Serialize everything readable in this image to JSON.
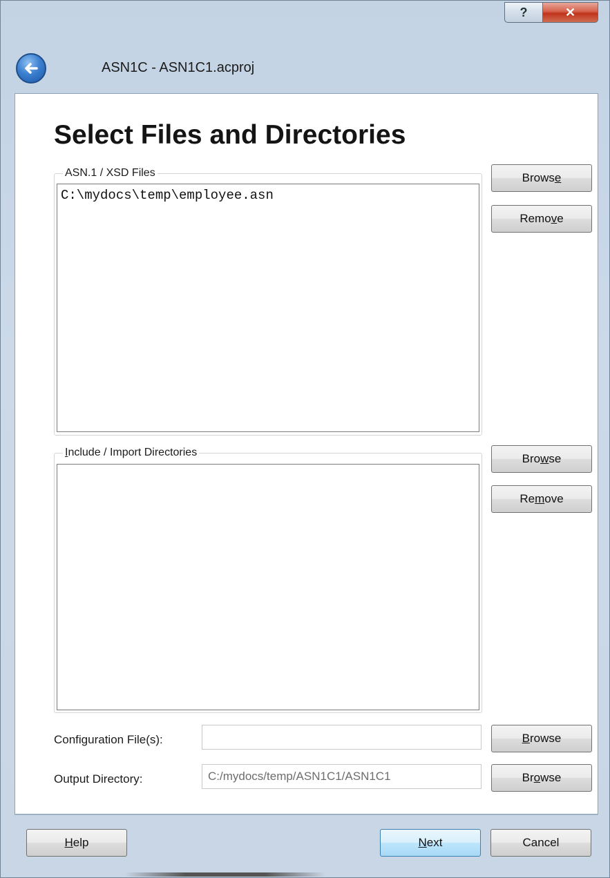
{
  "window": {
    "help_glyph": "?",
    "close_glyph": "✕",
    "back_icon": "back-arrow-icon",
    "title": "ASN1C - ASN1C1.acproj"
  },
  "page": {
    "title": "Select Files and Directories"
  },
  "asn_files": {
    "group_label": "ASN.1 / XSD Files",
    "items": [
      "C:\\mydocs\\temp\\employee.asn"
    ],
    "browse": {
      "pre": "Brows",
      "key": "e",
      "post": ""
    },
    "remove": {
      "pre": "Remo",
      "key": "v",
      "post": "e"
    }
  },
  "include_dirs": {
    "group_label": {
      "pre": "",
      "key": "I",
      "post": "nclude / Import Directories"
    },
    "items": [],
    "browse": {
      "pre": "Bro",
      "key": "w",
      "post": "se"
    },
    "remove": {
      "pre": "Re",
      "key": "m",
      "post": "ove"
    }
  },
  "config": {
    "label": "Configuration File(s):",
    "value": "",
    "browse": {
      "pre": "",
      "key": "B",
      "post": "rowse"
    }
  },
  "output": {
    "label": "Output Directory:",
    "placeholder": "C:/mydocs/temp/ASN1C1/ASN1C1",
    "browse": {
      "pre": "Br",
      "key": "o",
      "post": "wse"
    }
  },
  "footer": {
    "help": {
      "pre": "",
      "key": "H",
      "post": "elp"
    },
    "next": {
      "pre": "",
      "key": "N",
      "post": "ext"
    },
    "cancel": {
      "pre": "Cancel",
      "key": "",
      "post": ""
    }
  },
  "colors": {
    "accent": "#3c7fb1",
    "close": "#c0321c",
    "back": "#2f6fc0"
  }
}
